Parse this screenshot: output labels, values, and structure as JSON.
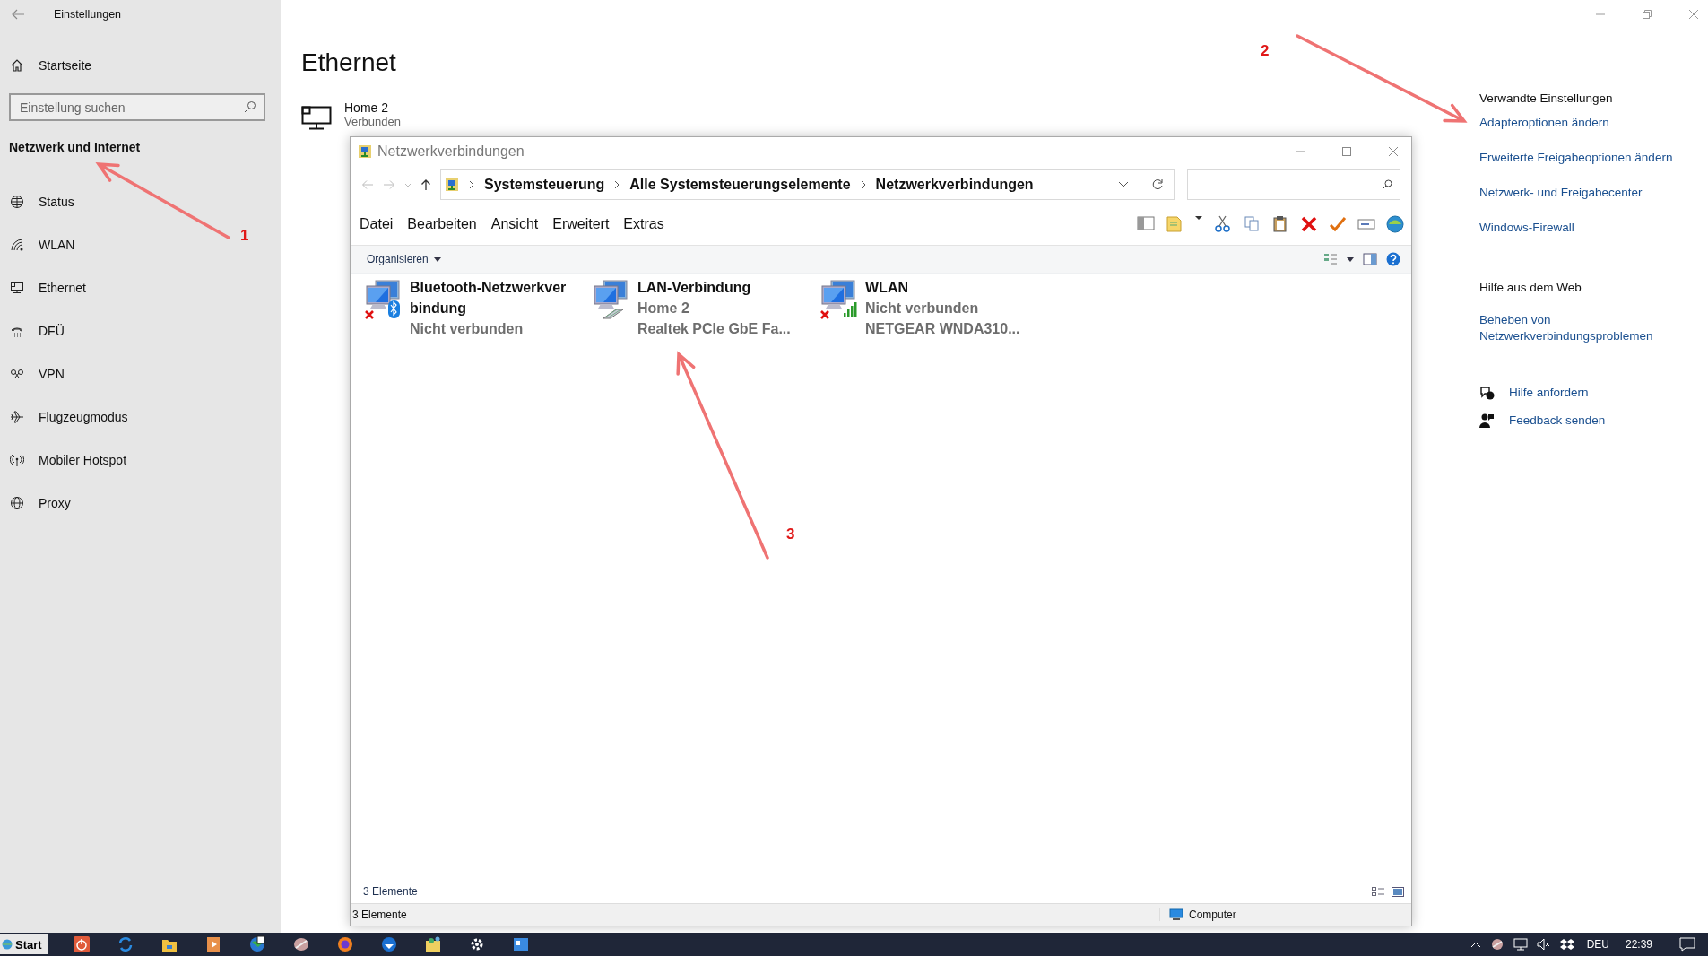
{
  "settings": {
    "title": "Einstellungen",
    "home": "Startseite",
    "search": {
      "placeholder": "Einstellung suchen"
    },
    "section": "Netzwerk und Internet",
    "nav": [
      {
        "label": "Status"
      },
      {
        "label": "WLAN"
      },
      {
        "label": "Ethernet"
      },
      {
        "label": "DFÜ"
      },
      {
        "label": "VPN"
      },
      {
        "label": "Flugzeugmodus"
      },
      {
        "label": "Mobiler Hotspot"
      },
      {
        "label": "Proxy"
      }
    ],
    "page_title": "Ethernet",
    "connection": {
      "name": "Home 2",
      "status": "Verbunden"
    },
    "related": {
      "heading": "Verwandte Einstellungen",
      "links": [
        "Adapteroptionen ändern",
        "Erweiterte Freigabeoptionen ändern",
        "Netzwerk- und Freigabecenter",
        "Windows-Firewall"
      ]
    },
    "web_help": {
      "heading": "Hilfe aus dem Web",
      "links": [
        "Beheben von Netzwerkverbindungsproblemen"
      ]
    },
    "support": [
      "Hilfe anfordern",
      "Feedback senden"
    ]
  },
  "explorer": {
    "title": "Netzwerkverbindungen",
    "breadcrumbs": [
      "Systemsteuerung",
      "Alle Systemsteuerungselemente",
      "Netzwerkverbindungen"
    ],
    "menu": [
      "Datei",
      "Bearbeiten",
      "Ansicht",
      "Erweitert",
      "Extras"
    ],
    "organize": "Organisieren",
    "items": [
      {
        "kind": "bluetooth",
        "connected": false,
        "name": "Bluetooth-Netzwerkverbindung",
        "line2": "Nicht verbunden"
      },
      {
        "kind": "lan",
        "connected": true,
        "name": "LAN-Verbindung",
        "line2": "Home 2",
        "line3": "Realtek PCIe GbE Fa..."
      },
      {
        "kind": "wlan",
        "connected": false,
        "name": "WLAN",
        "line2": "Nicht verbunden",
        "line3": "NETGEAR WNDA310..."
      }
    ],
    "count": "3 Elemente",
    "status_bar": {
      "count": "3 Elemente",
      "location": "Computer"
    }
  },
  "annotations": [
    {
      "label": "1"
    },
    {
      "label": "2"
    },
    {
      "label": "3"
    }
  ],
  "taskbar": {
    "start": "Start",
    "language": "DEU",
    "time": "22:39"
  }
}
